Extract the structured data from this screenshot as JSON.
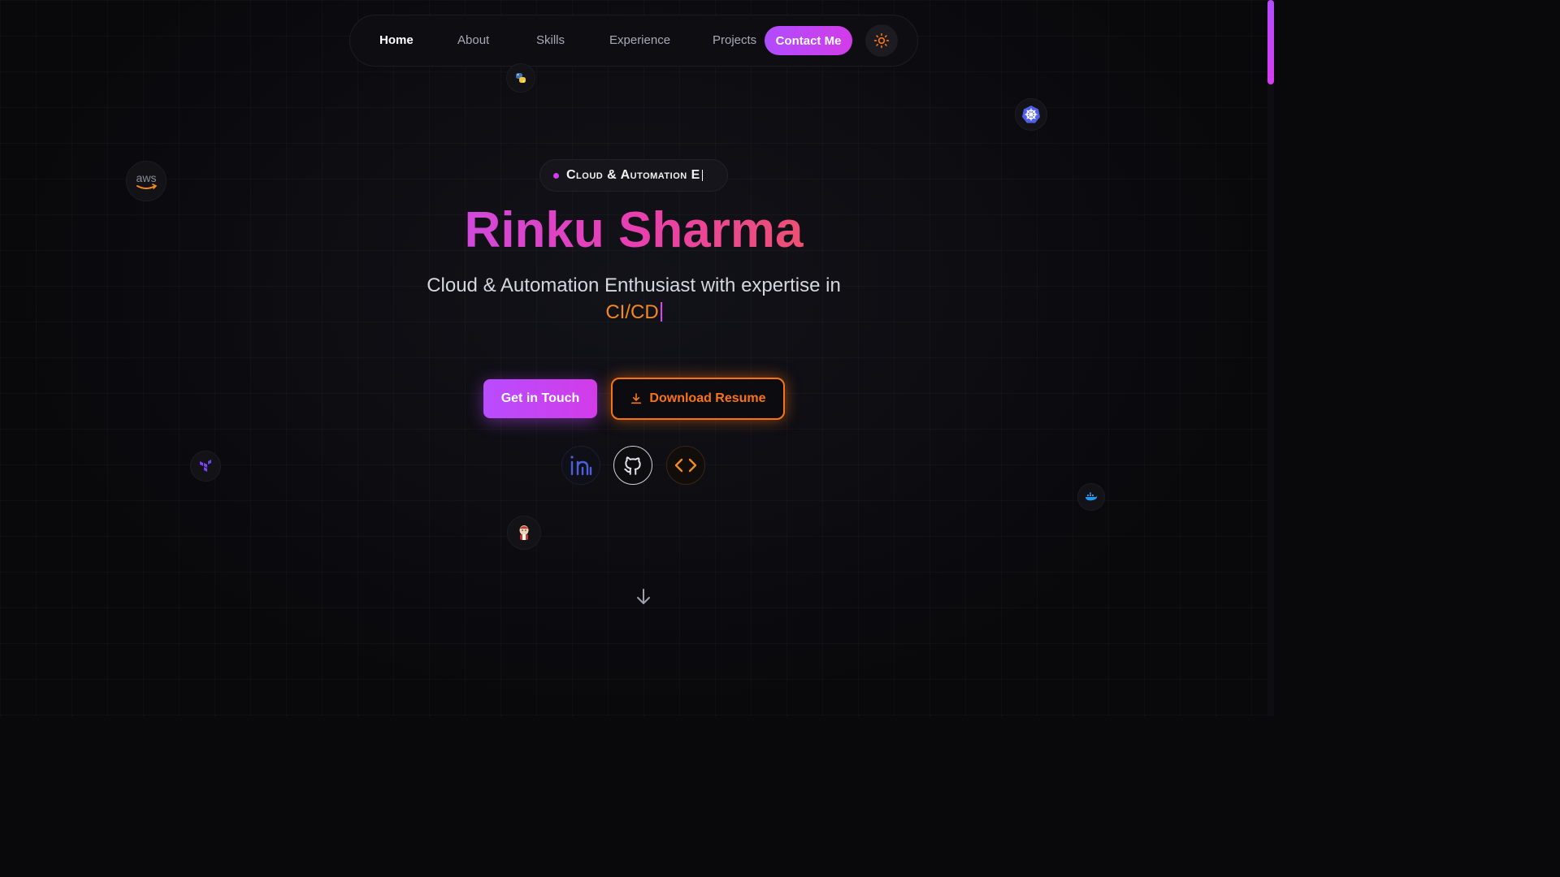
{
  "nav": {
    "items": [
      "Home",
      "About",
      "Skills",
      "Experience",
      "Projects"
    ],
    "contact_label": "Contact Me",
    "theme_icon": "sun-icon"
  },
  "hero": {
    "badge": "Cloud & Automation E",
    "name": "Rinku Sharma",
    "subtitle": "Cloud & Automation Enthusiast with expertise in",
    "role": "CI/CD",
    "cta_primary": "Get in Touch",
    "cta_secondary": "Download Resume"
  },
  "socials": [
    "linkedin-icon",
    "github-icon",
    "code-icon"
  ],
  "floating_icons": [
    "aws-icon",
    "python-icon",
    "kubernetes-icon",
    "terraform-icon",
    "jenkins-icon",
    "docker-icon"
  ],
  "floating_icon_labels": {
    "aws": "aws"
  },
  "colors": {
    "background": "#09090c",
    "purple": "#b84cff",
    "magenta": "#d23ce8",
    "orange": "#f97316"
  }
}
